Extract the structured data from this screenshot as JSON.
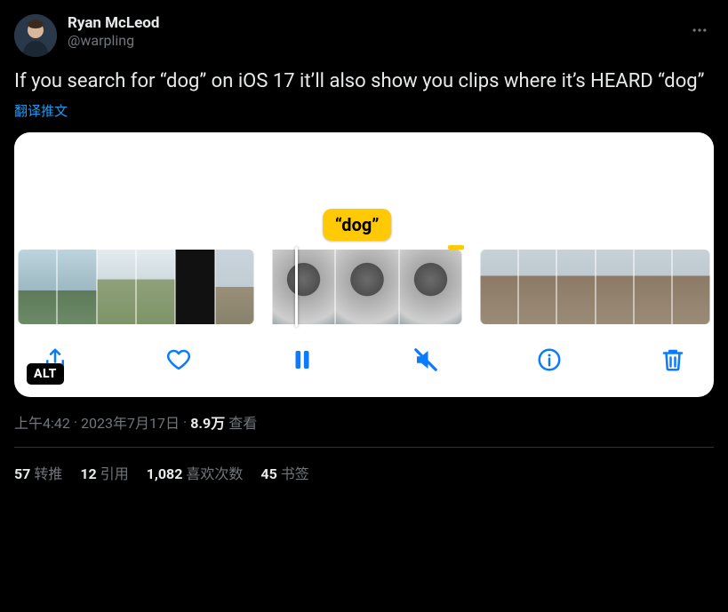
{
  "author": {
    "display_name": "Ryan McLeod",
    "handle": "@warpling"
  },
  "tweet": {
    "text": "If you search for “dog” on iOS 17 it’ll also show you clips where it’s HEARD “dog”",
    "translate_label": "翻译推文"
  },
  "media": {
    "caption_bubble": "“dog”",
    "alt_badge": "ALT"
  },
  "meta": {
    "time": "上午4:42",
    "dot1": " · ",
    "date": "2023年7月17日",
    "dot2": " · ",
    "views_count": "8.9万",
    "views_label": " 查看"
  },
  "stats": {
    "retweets": {
      "count": "57",
      "label": "转推"
    },
    "quotes": {
      "count": "12",
      "label": "引用"
    },
    "likes": {
      "count": "1,082",
      "label": "喜欢次数"
    },
    "bookmarks": {
      "count": "45",
      "label": "书签"
    }
  }
}
